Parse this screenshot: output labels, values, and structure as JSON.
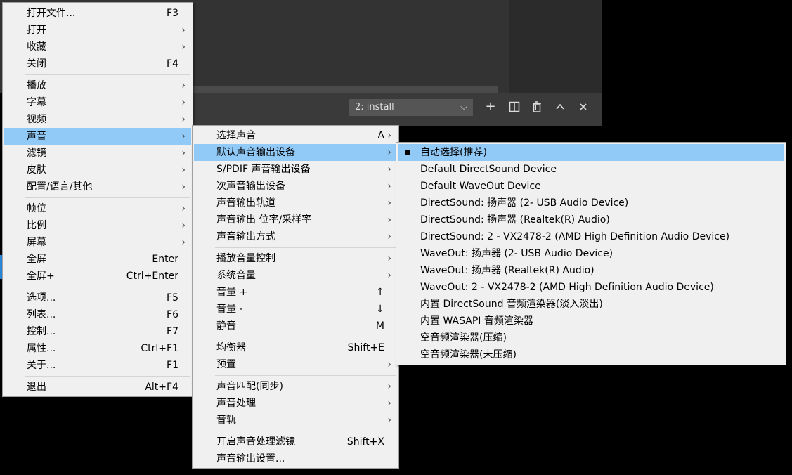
{
  "background": {
    "dropdown_value": "2: install",
    "toolbar_icons": [
      "plus-icon",
      "split-view-icon",
      "trash-icon",
      "chevron-up-icon",
      "close-icon"
    ]
  },
  "menu_main": [
    {
      "label": "打开文件...",
      "shortcut": "F3"
    },
    {
      "label": "打开",
      "submenu": true
    },
    {
      "label": "收藏",
      "submenu": true
    },
    {
      "label": "关闭",
      "shortcut": "F4"
    },
    {
      "sep": true
    },
    {
      "label": "播放",
      "submenu": true
    },
    {
      "label": "字幕",
      "submenu": true
    },
    {
      "label": "视频",
      "submenu": true
    },
    {
      "label": "声音",
      "submenu": true,
      "highlight": true
    },
    {
      "label": "滤镜",
      "submenu": true
    },
    {
      "label": "皮肤",
      "submenu": true
    },
    {
      "label": "配置/语言/其他",
      "submenu": true
    },
    {
      "sep": true
    },
    {
      "label": "帧位",
      "submenu": true
    },
    {
      "label": "比例",
      "submenu": true
    },
    {
      "label": "屏幕",
      "submenu": true
    },
    {
      "label": "全屏",
      "shortcut": "Enter"
    },
    {
      "label": "全屏+",
      "shortcut": "Ctrl+Enter"
    },
    {
      "sep": true
    },
    {
      "label": "选项...",
      "shortcut": "F5"
    },
    {
      "label": "列表...",
      "shortcut": "F6"
    },
    {
      "label": "控制...",
      "shortcut": "F7"
    },
    {
      "label": "属性...",
      "shortcut": "Ctrl+F1"
    },
    {
      "label": "关于...",
      "shortcut": "F1"
    },
    {
      "sep": true
    },
    {
      "label": "退出",
      "shortcut": "Alt+F4"
    }
  ],
  "menu_audio": [
    {
      "label": "选择声音",
      "shortcut": "A",
      "submenu": true
    },
    {
      "label": "默认声音输出设备",
      "submenu": true,
      "highlight": true
    },
    {
      "label": "S/PDIF 声音输出设备",
      "submenu": true
    },
    {
      "label": "次声音输出设备",
      "submenu": true
    },
    {
      "label": "声音输出轨道",
      "submenu": true
    },
    {
      "label": "声音输出 位率/采样率",
      "submenu": true
    },
    {
      "label": "声音输出方式",
      "submenu": true
    },
    {
      "sep": true
    },
    {
      "label": "播放音量控制",
      "submenu": true
    },
    {
      "label": "系统音量",
      "submenu": true
    },
    {
      "label": "音量 +",
      "shortcut": "↑"
    },
    {
      "label": "音量 -",
      "shortcut": "↓"
    },
    {
      "label": "静音",
      "shortcut": "M"
    },
    {
      "sep": true
    },
    {
      "label": "均衡器",
      "shortcut": "Shift+E"
    },
    {
      "label": "预置",
      "submenu": true
    },
    {
      "sep": true
    },
    {
      "label": "声音匹配(同步)",
      "submenu": true
    },
    {
      "label": "声音处理",
      "submenu": true
    },
    {
      "label": "音轨",
      "submenu": true
    },
    {
      "sep": true
    },
    {
      "label": "开启声音处理滤镜",
      "shortcut": "Shift+X"
    },
    {
      "label": "声音输出设置..."
    }
  ],
  "menu_devices": [
    {
      "label": "自动选择(推荐)",
      "checked": true,
      "highlight": true
    },
    {
      "label": "Default DirectSound Device"
    },
    {
      "label": "Default WaveOut Device"
    },
    {
      "label": "DirectSound: 扬声器 (2- USB Audio Device)"
    },
    {
      "label": "DirectSound: 扬声器 (Realtek(R) Audio)"
    },
    {
      "label": "DirectSound: 2 - VX2478-2 (AMD High Definition Audio Device)"
    },
    {
      "label": "WaveOut: 扬声器 (2- USB Audio Device)"
    },
    {
      "label": "WaveOut: 扬声器 (Realtek(R) Audio)"
    },
    {
      "label": "WaveOut: 2 - VX2478-2 (AMD High Definition Audio Device)"
    },
    {
      "label": "内置 DirectSound 音频渲染器(淡入淡出)"
    },
    {
      "label": "内置 WASAPI 音频渲染器"
    },
    {
      "label": "空音频渲染器(压缩)"
    },
    {
      "label": "空音频渲染器(未压缩)"
    }
  ],
  "colors": {
    "highlight": "#91c9f7",
    "menu_bg": "#f0f0f0"
  }
}
